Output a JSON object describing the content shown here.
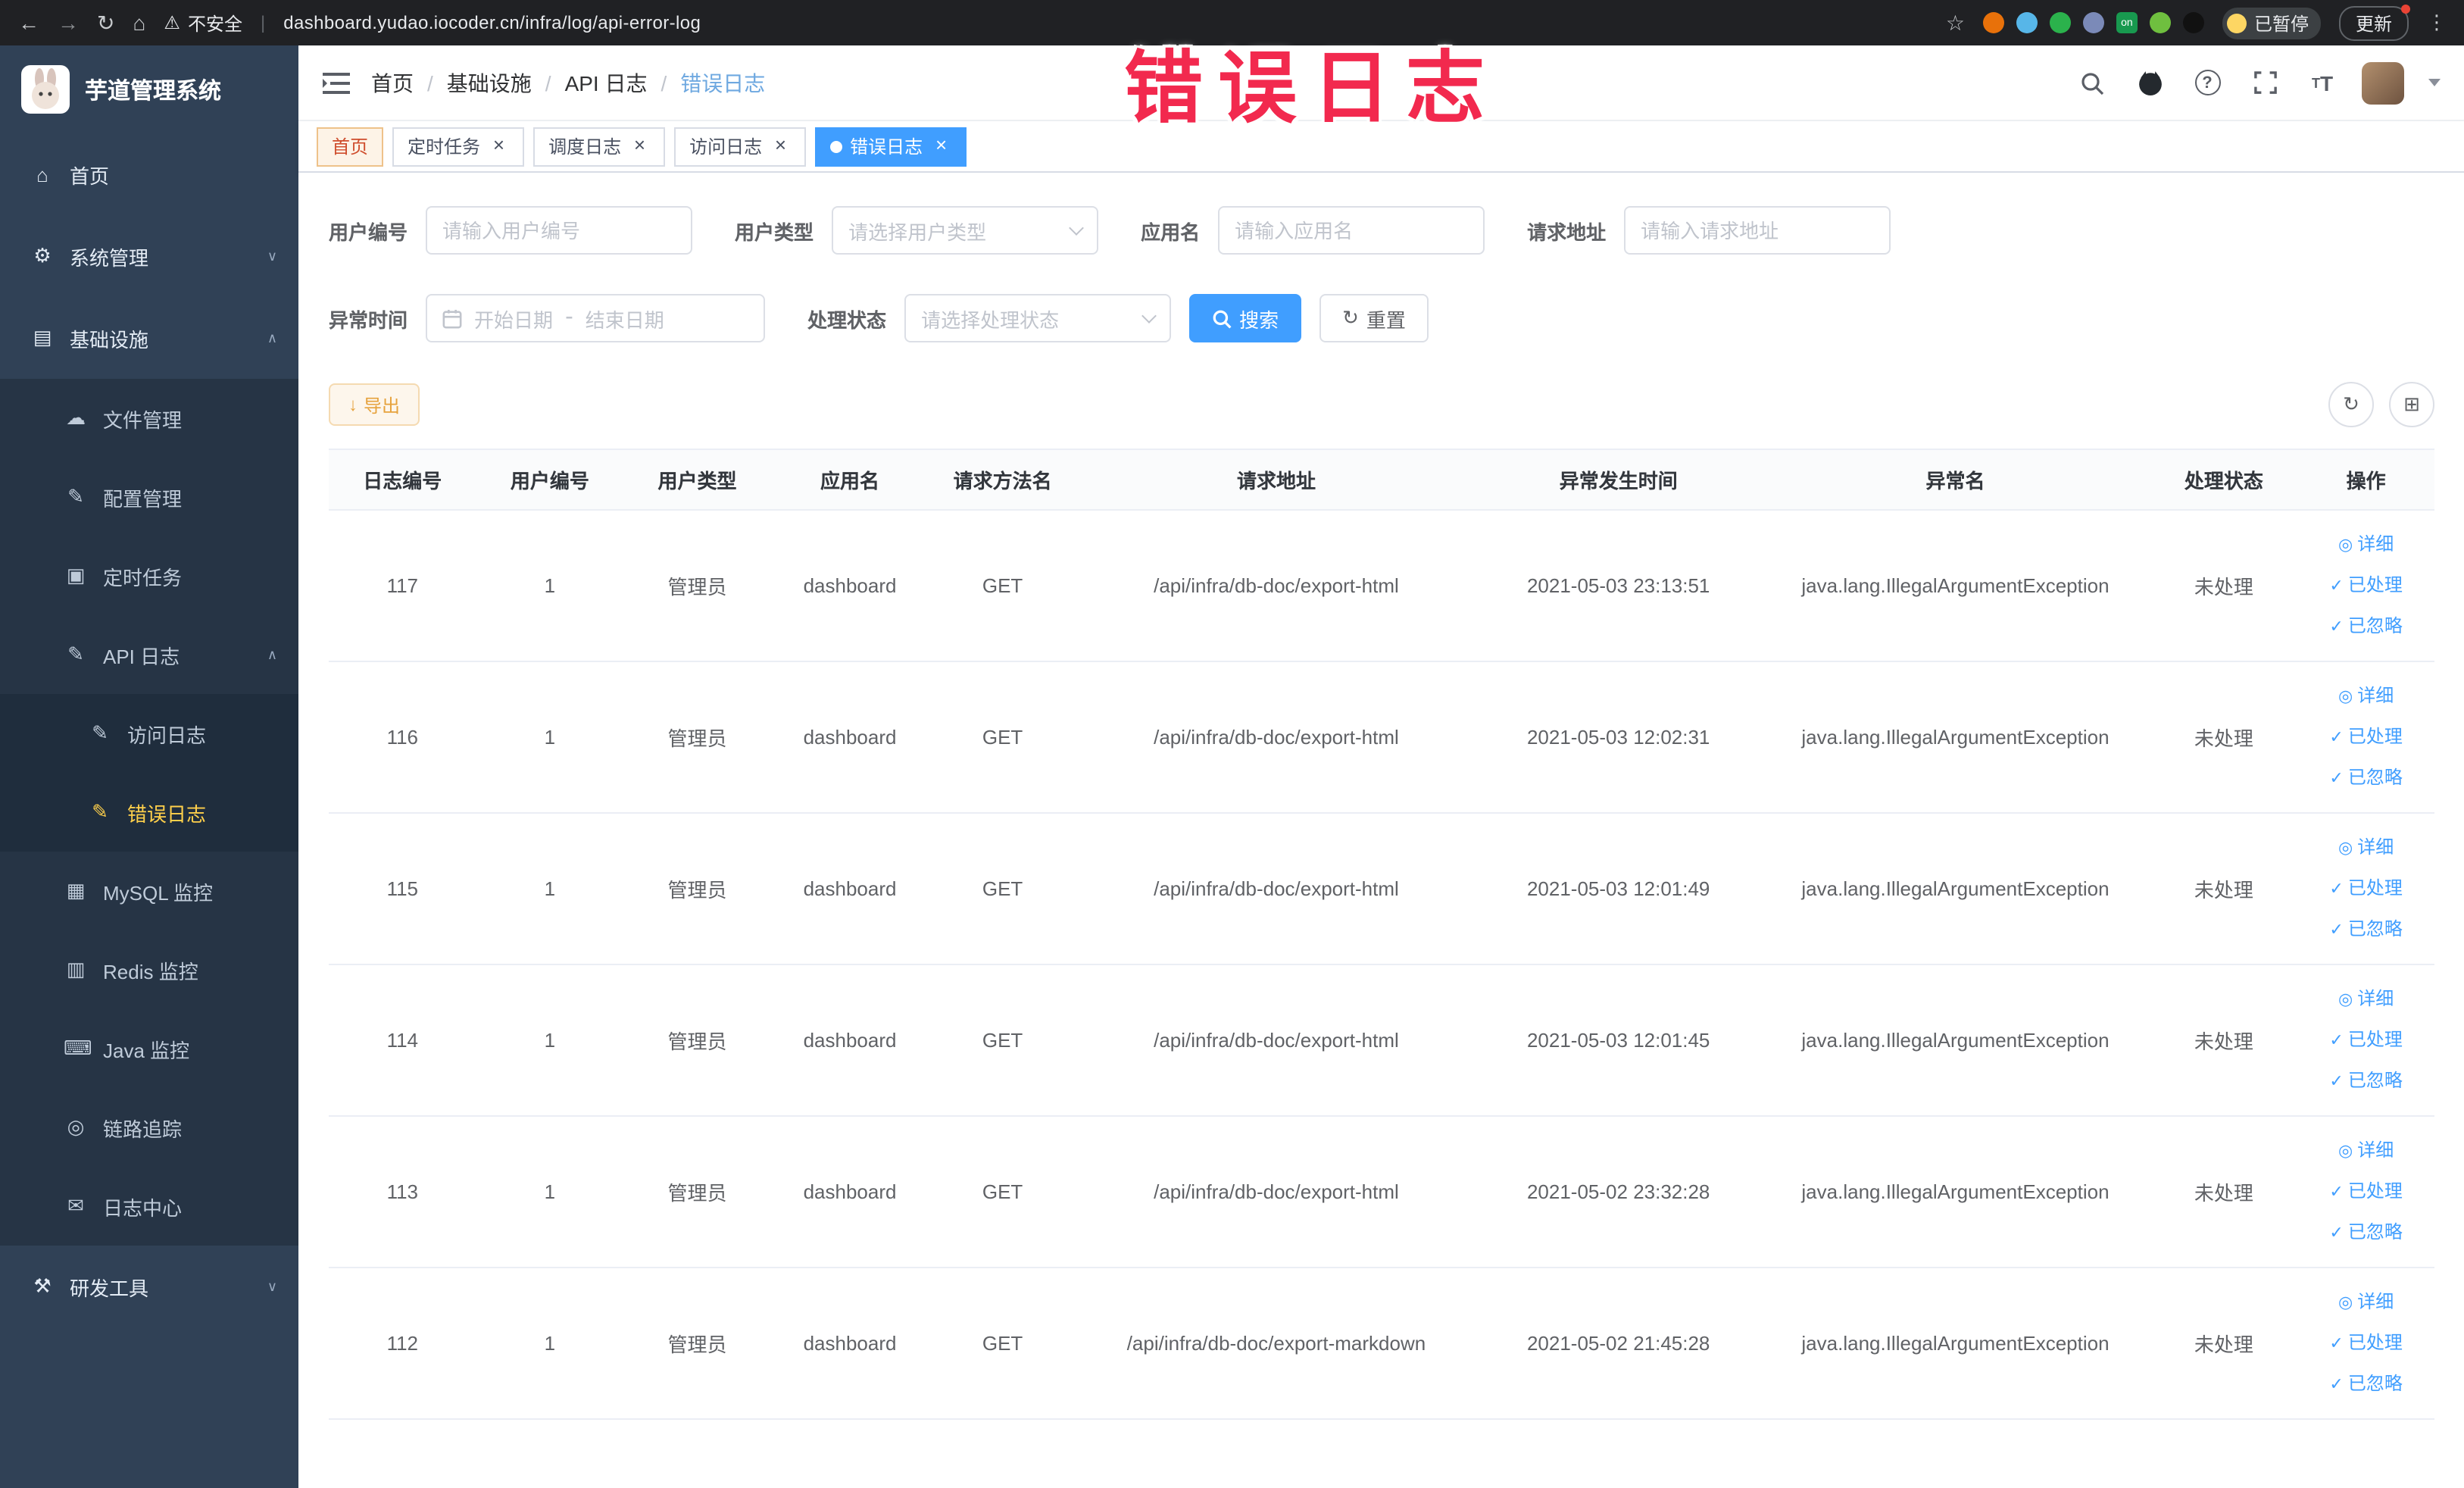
{
  "browser": {
    "security_label": "不安全",
    "url": "dashboard.yudao.iocoder.cn/infra/log/api-error-log",
    "paused_badge": "已暂停",
    "update_label": "更新",
    "extensions": [
      {
        "name": "extension-red-icon",
        "color": "#e8710a",
        "shape": "circle"
      },
      {
        "name": "extension-drop-icon",
        "color": "#57b6e8",
        "shape": "circle"
      },
      {
        "name": "extension-green-circle-icon",
        "color": "#2bb24c",
        "shape": "circle"
      },
      {
        "name": "extension-grid-icon",
        "color": "#7b8ab8",
        "shape": "circle"
      },
      {
        "name": "extension-on-badge-icon",
        "color": "#18994f",
        "shape": "square",
        "label": "on"
      },
      {
        "name": "extension-leaf-icon",
        "color": "#6fbf3f",
        "shape": "circle"
      },
      {
        "name": "extension-bot-icon",
        "color": "#111111",
        "shape": "circle"
      }
    ]
  },
  "annotation": {
    "text": "错误日志",
    "color": "#f2294e"
  },
  "sidebar": {
    "logo_title": "芋道管理系统",
    "items": [
      {
        "key": "home",
        "label": "首页",
        "icon": "home-icon",
        "level": 1
      },
      {
        "key": "system-manage",
        "label": "系统管理",
        "icon": "gear-icon",
        "level": 1,
        "submenu": true,
        "expanded": false
      },
      {
        "key": "infrastructure",
        "label": "基础设施",
        "icon": "infrastructure-icon",
        "level": 1,
        "submenu": true,
        "expanded": true
      },
      {
        "key": "file-manage",
        "label": "文件管理",
        "icon": "file-manage-icon",
        "level": 2
      },
      {
        "key": "config-manage",
        "label": "配置管理",
        "icon": "config-manage-icon",
        "level": 2
      },
      {
        "key": "scheduled-job",
        "label": "定时任务",
        "icon": "scheduled-job-icon",
        "level": 2
      },
      {
        "key": "api-log",
        "label": "API 日志",
        "icon": "api-log-icon",
        "level": 2,
        "submenu": true,
        "expanded": true
      },
      {
        "key": "access-log",
        "label": "访问日志",
        "icon": "access-log-icon",
        "level": 3
      },
      {
        "key": "error-log",
        "label": "错误日志",
        "icon": "error-log-icon",
        "level": 3,
        "active": true
      },
      {
        "key": "mysql-monitor",
        "label": "MySQL 监控",
        "icon": "mysql-monitor-icon",
        "level": 2
      },
      {
        "key": "redis-monitor",
        "label": "Redis 监控",
        "icon": "redis-monitor-icon",
        "level": 2
      },
      {
        "key": "java-monitor",
        "label": "Java 监控",
        "icon": "java-monitor-icon",
        "level": 2
      },
      {
        "key": "trace",
        "label": "链路追踪",
        "icon": "trace-icon",
        "level": 2
      },
      {
        "key": "log-center",
        "label": "日志中心",
        "icon": "log-center-icon",
        "level": 2
      },
      {
        "key": "devtools",
        "label": "研发工具",
        "icon": "devtools-icon",
        "level": 1,
        "submenu": true,
        "expanded": false
      }
    ]
  },
  "header": {
    "breadcrumb": [
      "首页",
      "基础设施",
      "API 日志",
      "错误日志"
    ]
  },
  "tabs": [
    {
      "key": "home",
      "label": "首页",
      "closable": false,
      "affix": true
    },
    {
      "key": "scheduled-job",
      "label": "定时任务",
      "closable": true
    },
    {
      "key": "schedule-log",
      "label": "调度日志",
      "closable": true
    },
    {
      "key": "access-log",
      "label": "访问日志",
      "closable": true
    },
    {
      "key": "error-log",
      "label": "错误日志",
      "closable": true,
      "active": true
    }
  ],
  "filters": {
    "user_id": {
      "label": "用户编号",
      "placeholder": "请输入用户编号"
    },
    "user_type": {
      "label": "用户类型",
      "placeholder": "请选择用户类型"
    },
    "app_name": {
      "label": "应用名",
      "placeholder": "请输入应用名"
    },
    "request_url": {
      "label": "请求地址",
      "placeholder": "请输入请求地址"
    },
    "exception_time": {
      "label": "异常时间",
      "start_placeholder": "开始日期",
      "separator": "-",
      "end_placeholder": "结束日期"
    },
    "process_status": {
      "label": "处理状态",
      "placeholder": "请选择处理状态"
    },
    "search_label": "搜索",
    "reset_label": "重置"
  },
  "toolbar": {
    "export_label": "导出"
  },
  "table": {
    "columns": [
      "日志编号",
      "用户编号",
      "用户类型",
      "应用名",
      "请求方法名",
      "请求地址",
      "异常发生时间",
      "异常名",
      "处理状态",
      "操作"
    ],
    "row_actions": [
      "详细",
      "已处理",
      "已忽略"
    ],
    "rows": [
      {
        "id": "117",
        "user_id": "1",
        "user_type": "管理员",
        "app": "dashboard",
        "method": "GET",
        "url": "/api/infra/db-doc/export-html",
        "time": "2021-05-03 23:13:51",
        "exception": "java.lang.IllegalArgumentException",
        "status": "未处理"
      },
      {
        "id": "116",
        "user_id": "1",
        "user_type": "管理员",
        "app": "dashboard",
        "method": "GET",
        "url": "/api/infra/db-doc/export-html",
        "time": "2021-05-03 12:02:31",
        "exception": "java.lang.IllegalArgumentException",
        "status": "未处理"
      },
      {
        "id": "115",
        "user_id": "1",
        "user_type": "管理员",
        "app": "dashboard",
        "method": "GET",
        "url": "/api/infra/db-doc/export-html",
        "time": "2021-05-03 12:01:49",
        "exception": "java.lang.IllegalArgumentException",
        "status": "未处理"
      },
      {
        "id": "114",
        "user_id": "1",
        "user_type": "管理员",
        "app": "dashboard",
        "method": "GET",
        "url": "/api/infra/db-doc/export-html",
        "time": "2021-05-03 12:01:45",
        "exception": "java.lang.IllegalArgumentException",
        "status": "未处理"
      },
      {
        "id": "113",
        "user_id": "1",
        "user_type": "管理员",
        "app": "dashboard",
        "method": "GET",
        "url": "/api/infra/db-doc/export-html",
        "time": "2021-05-02 23:32:28",
        "exception": "java.lang.IllegalArgumentException",
        "status": "未处理"
      },
      {
        "id": "112",
        "user_id": "1",
        "user_type": "管理员",
        "app": "dashboard",
        "method": "GET",
        "url": "/api/infra/db-doc/export-markdown",
        "time": "2021-05-02 21:45:28",
        "exception": "java.lang.IllegalArgumentException",
        "status": "未处理"
      }
    ]
  },
  "colors": {
    "primary": "#409eff",
    "sidebar_bg": "#304156",
    "active_menu": "#ffd04b",
    "warning": "#e6a23c"
  }
}
